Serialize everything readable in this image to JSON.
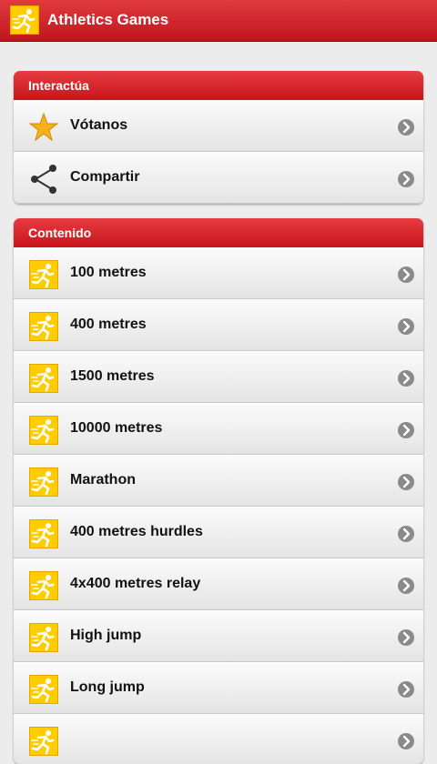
{
  "app": {
    "title": "Athletics Games",
    "logo_icon": "runner-icon",
    "accent": "#d0181f",
    "icon_bg": "#ffcc00"
  },
  "interact": {
    "title": "Interactúa",
    "items": [
      {
        "label": "Vótanos",
        "icon": "star-icon"
      },
      {
        "label": "Compartir",
        "icon": "share-icon"
      }
    ]
  },
  "content": {
    "title": "Contenido",
    "items": [
      {
        "label": "100 metres",
        "icon": "runner-icon"
      },
      {
        "label": "400 metres",
        "icon": "runner-icon"
      },
      {
        "label": "1500 metres",
        "icon": "runner-icon"
      },
      {
        "label": "10000 metres",
        "icon": "runner-icon"
      },
      {
        "label": "Marathon",
        "icon": "runner-icon"
      },
      {
        "label": "400 metres hurdles",
        "icon": "runner-icon"
      },
      {
        "label": "4x400 metres relay",
        "icon": "runner-icon"
      },
      {
        "label": "High jump",
        "icon": "runner-icon"
      },
      {
        "label": "Long jump",
        "icon": "runner-icon"
      },
      {
        "label": "",
        "icon": "runner-icon"
      }
    ]
  }
}
